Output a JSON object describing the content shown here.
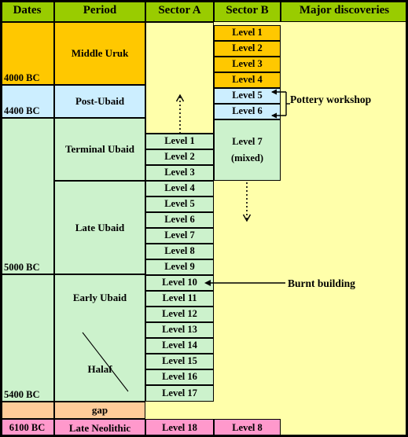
{
  "table": {
    "headers": [
      {
        "label": "Dates"
      },
      {
        "label": "Period"
      },
      {
        "label": "Sector A"
      },
      {
        "label": "Sector B"
      },
      {
        "label": "Major discoveries"
      }
    ],
    "dates": [
      {
        "label": "4000 BC"
      },
      {
        "label": "4400 BC"
      },
      {
        "label": "5000 BC"
      },
      {
        "label": "5400 BC"
      },
      {
        "label": "6100 BC"
      }
    ],
    "periods": [
      {
        "label": "Middle Uruk"
      },
      {
        "label": "Post-Ubaid"
      },
      {
        "label": "Terminal Ubaid"
      },
      {
        "label": "Late Ubaid"
      },
      {
        "label": "Early Ubaid"
      },
      {
        "label": "Halaf"
      },
      {
        "label": "gap"
      },
      {
        "label": "Late Neolithic"
      }
    ],
    "sector_a_levels": [
      {
        "label": "Level 1"
      },
      {
        "label": "Level 2"
      },
      {
        "label": "Level 3"
      },
      {
        "label": "Level 4"
      },
      {
        "label": "Level 5"
      },
      {
        "label": "Level 6"
      },
      {
        "label": "Level 7"
      },
      {
        "label": "Level 8"
      },
      {
        "label": "Level 9"
      },
      {
        "label": "Level 10"
      },
      {
        "label": "Level 11"
      },
      {
        "label": "Level 12"
      },
      {
        "label": "Level 13"
      },
      {
        "label": "Level 14"
      },
      {
        "label": "Level 15"
      },
      {
        "label": "Level 16"
      },
      {
        "label": "Level 17"
      },
      {
        "label": "Level 18"
      }
    ],
    "sector_b_levels": [
      {
        "label": "Level 1"
      },
      {
        "label": "Level 2"
      },
      {
        "label": "Level 3"
      },
      {
        "label": "Level 4"
      },
      {
        "label": "Level 5"
      },
      {
        "label": "Level 6"
      },
      {
        "label": "Level 7"
      },
      {
        "label": "Level 7 sub",
        "value": "(mixed)"
      },
      {
        "label": "Level 8"
      }
    ],
    "discoveries": [
      {
        "label": "Pottery workshop"
      },
      {
        "label": "Burnt building"
      }
    ]
  },
  "colors": {
    "header_green": "#99cc00",
    "orange": "#ffc800",
    "light_blue": "#cceeff",
    "light_green": "#ccf2cc",
    "peach": "#ffcc99",
    "pink": "#ff99cc",
    "pale_yellow": "#ffffaa",
    "border": "#000000"
  }
}
